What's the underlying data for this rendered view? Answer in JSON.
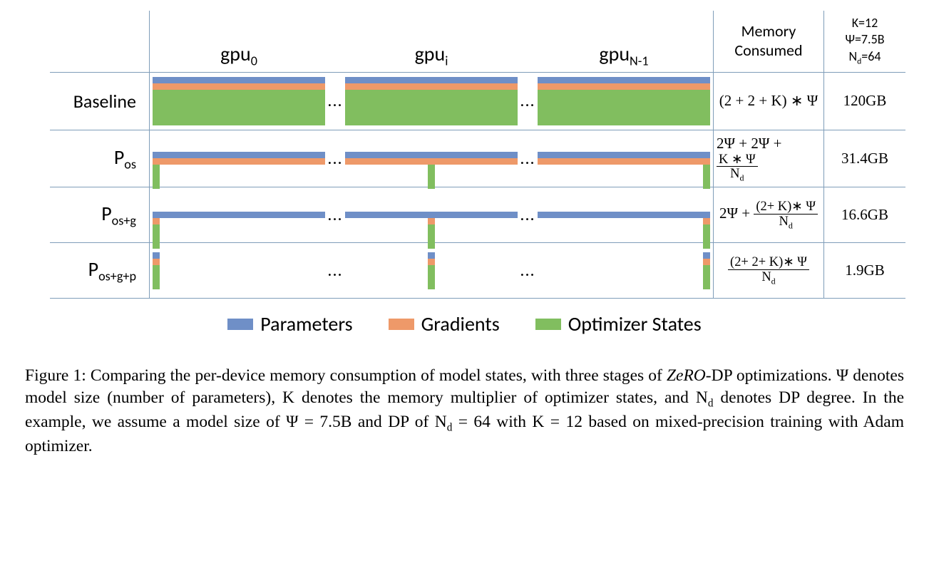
{
  "gpu_headers": {
    "g0": "gpu",
    "g0_sub": "0",
    "g1": "gpu",
    "g1_sub": "i",
    "g2": "gpu",
    "g2_sub": "N-1"
  },
  "col_headers": {
    "memory": "Memory Consumed",
    "ex_k": "K=12",
    "ex_psi": "Ψ=7.5B",
    "ex_nd_a": "N",
    "ex_nd_b": "d",
    "ex_nd_c": "=64"
  },
  "rows": {
    "baseline": {
      "label": "Baseline",
      "formula_a": "(2 + 2 + K) ∗ Ψ",
      "value": "120GB"
    },
    "pos": {
      "label_a": "P",
      "label_b": "os",
      "formula_a": "2Ψ + 2Ψ + ",
      "frac_num": "K ∗ Ψ",
      "frac_den_a": "N",
      "frac_den_b": "d",
      "value": "31.4GB"
    },
    "posg": {
      "label_a": "P",
      "label_b": "os+g",
      "formula_a": "2Ψ + ",
      "frac_num": "(2+ K)∗ Ψ",
      "frac_den_a": "N",
      "frac_den_b": "d",
      "value": "16.6GB"
    },
    "posgp": {
      "label_a": "P",
      "label_b": "os+g+p",
      "frac_num": "(2+ 2+ K)∗ Ψ",
      "frac_den_a": "N",
      "frac_den_b": "d",
      "value": "1.9GB"
    }
  },
  "legend": {
    "params": "Parameters",
    "grads": "Gradients",
    "opt": "Optimizer States"
  },
  "caption": {
    "prefix": "Figure 1: Comparing the per-device memory consumption of model states, with three stages of ",
    "em": "ZeRO",
    "mid": "-DP optimizations. Ψ denotes model size (number of parameters), K denotes the memory multiplier of optimizer states, and N",
    "sub1": "d",
    "mid2": " denotes DP degree. In the example, we assume a model size of Ψ = 7.5B and DP of N",
    "sub2": "d",
    "tail": " = 64 with K = 12 based on mixed-precision training with Adam optimizer."
  },
  "dots": "..."
}
